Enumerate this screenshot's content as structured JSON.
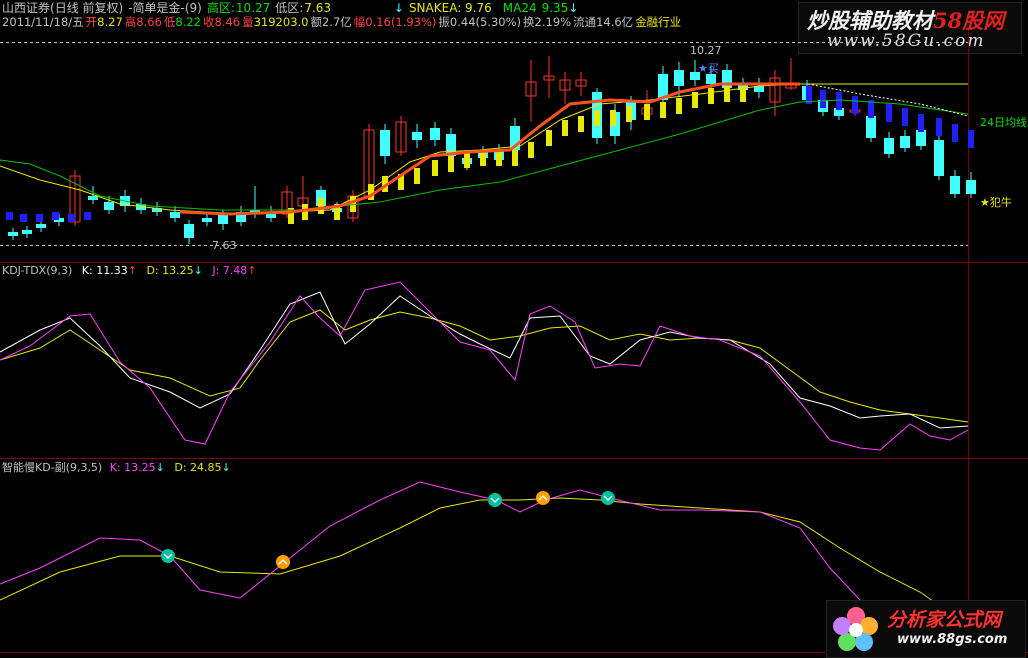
{
  "header": {
    "stock_name": "山西证券",
    "chart_mode": "(日线 前复权)",
    "formula": "-简单是金-(9)",
    "upper_zone_label": "高区:",
    "upper_zone_value": "10.27",
    "lower_zone_label": "低区:",
    "lower_zone_value": "7.63",
    "snakea_label": "SNAKEA: 9.76",
    "ma24_label": "MA24",
    "ma24_value": "9.35"
  },
  "quote": {
    "date": "2011/11/18/五",
    "open_label": "开",
    "open": "8.27",
    "high_label": "高",
    "high": "8.66",
    "low_label": "低",
    "low": "8.22",
    "close_label": "收",
    "close": "8.46",
    "volume_label": "量",
    "volume": "319203.0",
    "amount_label": "额",
    "amount": "2.7亿",
    "change_label": "幅",
    "change": "0.16(1.93%)",
    "amplitude": "振0.44(5.30%)",
    "turnover": "换2.19%",
    "float_cap": "流通14.6亿",
    "industry": "金融行业"
  },
  "price_annotations": {
    "high_marker": "10.27",
    "low_marker": "7.63",
    "ma_tag": "24日均线",
    "star_top": "★买",
    "star_bottom": "★犯牛"
  },
  "kdj_panel": {
    "title": "KDJ-TDX(9,3)",
    "k_label": "K: 11.33",
    "d_label": "D: 13.25",
    "j_label": "J: 7.48"
  },
  "kd_panel": {
    "title": "智能慢KD-副(9,3,5)",
    "k_label": "K: 13.25",
    "d_label": "D: 24.85"
  },
  "watermarks": {
    "top_site": "炒股辅助教材",
    "top_site_accent": "58股网",
    "top_url": "www.58Gu.com",
    "bottom_site": "分析家公式网",
    "bottom_url": "www.88gs.com"
  },
  "colors": {
    "up_candle": "#ff3030",
    "down_candle": "#40ffff",
    "k_line": "#ffffff",
    "d_line": "#e8e800",
    "j_line": "#ff40ff",
    "ma_line": "#00c000"
  }
}
